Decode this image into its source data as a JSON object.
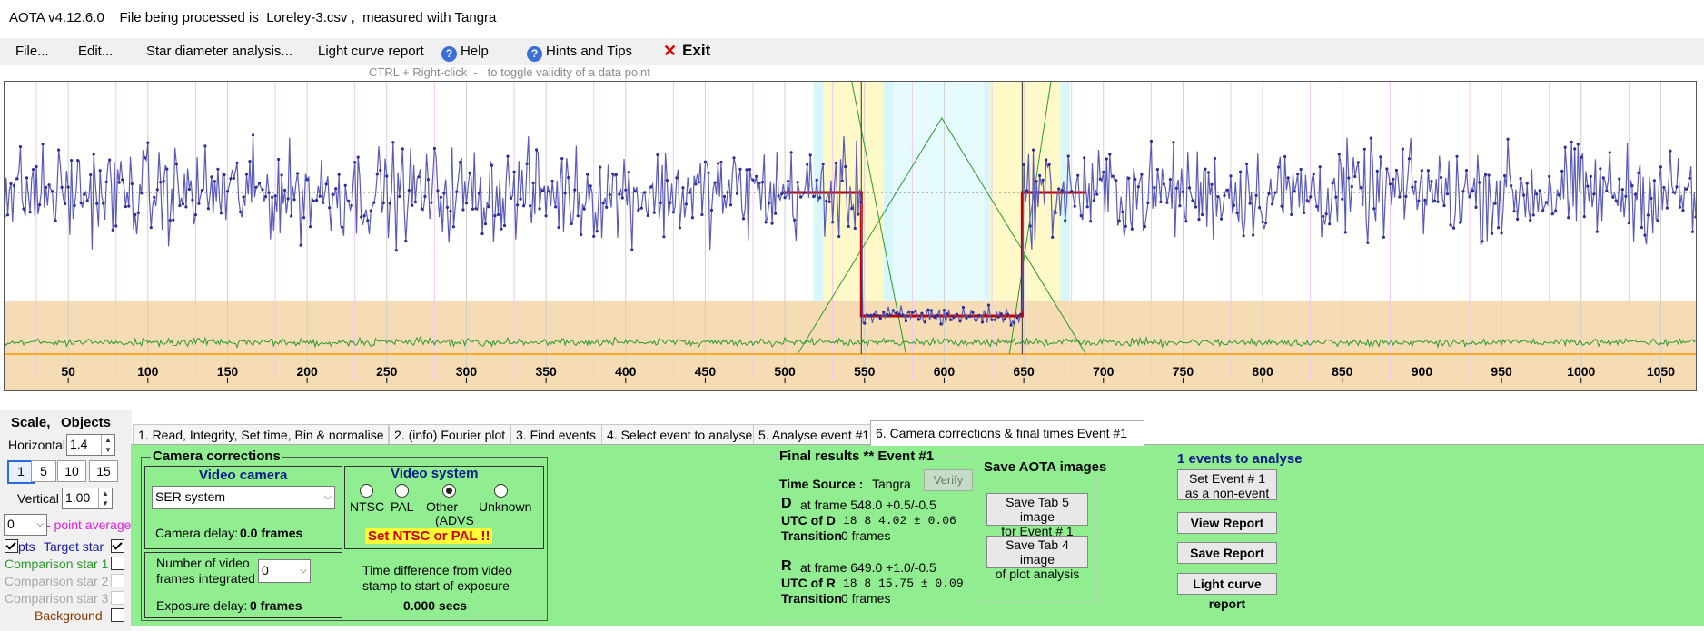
{
  "window": {
    "title": "AOTA v4.12.6.0    File being processed is  Loreley-3.csv ,  measured with Tangra"
  },
  "menu": {
    "file": "File...",
    "edit": "Edit...",
    "star_diameter": "Star diameter analysis...",
    "light_curve_report": "Light curve report",
    "help": "Help",
    "hints": "Hints and Tips",
    "exit": "Exit"
  },
  "hint_text": "CTRL + Right-click  -   to toggle validity of a data point",
  "icons": {
    "help": "question-circle-icon",
    "exit": "close-x-icon",
    "dropdown": "chevron-down-icon",
    "spin": "up-down-arrows-icon"
  },
  "colors": {
    "panel_green": "#90ee90",
    "series_blue": "#2d2d96",
    "fit_red": "#c00000",
    "comparison_green": "#2a9a2a",
    "background_band": "#f5dcb4"
  },
  "chart_data": {
    "type": "line",
    "x_ticks": [
      50,
      100,
      150,
      200,
      250,
      300,
      350,
      400,
      450,
      500,
      550,
      600,
      650,
      700,
      750,
      800,
      850,
      900,
      950,
      1000,
      1050
    ],
    "xlim": [
      10,
      1072
    ],
    "series": [
      {
        "role": "target_star",
        "level_outside_event": 1.0,
        "level_during_event": 0.0
      },
      {
        "role": "background",
        "level": 0.0
      }
    ],
    "event": {
      "d_frame": 548.0,
      "r_frame": 649.0
    }
  },
  "scale": {
    "title": "Scale,",
    "objects": "Objects",
    "horizontal_label": "Horizontal",
    "horizontal_value": "1.4",
    "buttons": [
      "1",
      "5",
      "10",
      "15"
    ],
    "vertical_label": "Vertical",
    "vertical_value": "1.00",
    "point_avg_value": "0",
    "point_avg_label": "- point average",
    "pts": "pts",
    "target": "Target star",
    "comp1": "Comparison star 1",
    "comp2": "Comparison star 2",
    "comp3": "Comparison star 3",
    "background": "Background"
  },
  "tabs": [
    "1.  Read, Integrity, Set time, Bin & normalise",
    "2. (info)  Fourier plot",
    "3. Find events",
    "4. Select event to analyse",
    "5. Analyse event #1",
    "6. Camera corrections & final times Event #1"
  ],
  "camera": {
    "header": "Camera corrections",
    "video_camera": "Video camera",
    "camera_value": "SER system",
    "camera_delay": "Camera delay:",
    "camera_delay_value": "0.0 frames",
    "video_system": "Video system",
    "opt_ntsc": "NTSC",
    "opt_pal": "PAL",
    "opt_other": "Other",
    "opt_other2": "(ADVS",
    "opt_unknown": "Unknown",
    "warn": "Set NTSC or PAL !!",
    "num_frames_l1": "Number of video",
    "num_frames_l2": "frames integrated",
    "num_frames_value": "0",
    "exposure_delay": "Exposure delay:",
    "exposure_delay_value": "0 frames",
    "time_diff_l1": "Time difference from video",
    "time_diff_l2": "stamp to start of exposure",
    "time_diff_value": "0.000 secs"
  },
  "results": {
    "header": "Final results  **  Event #1",
    "time_source_label": "Time Source :",
    "time_source": "Tangra",
    "verify": "Verify",
    "d_label": "D",
    "d_frame": "at frame 548.0 +0.5/-0.5",
    "utc_d_label": "UTC of D",
    "utc_d": "18  8  4.02 ± 0.06",
    "transition_label": "Transition",
    "transition_d": "0 frames",
    "r_label": "R",
    "r_frame": "at frame 649.0 +1.0/-0.5",
    "utc_r_label": "UTC of R",
    "utc_r": "18  8 15.75 ± 0.09",
    "transition_r": "0 frames"
  },
  "save": {
    "header": "Save AOTA images",
    "btn_tab5_l1": "Save Tab 5 image",
    "btn_tab5_l2": "for Event # 1",
    "btn_tab4_l1": "Save Tab 4 image",
    "btn_tab4_l2": "of plot analysis"
  },
  "reports": {
    "events": "1 events to analyse",
    "set_event_l1": "Set Event # 1",
    "set_event_l2": "as a non-event",
    "view": "View Report",
    "save": "Save Report",
    "light_curve": "Light curve report"
  }
}
